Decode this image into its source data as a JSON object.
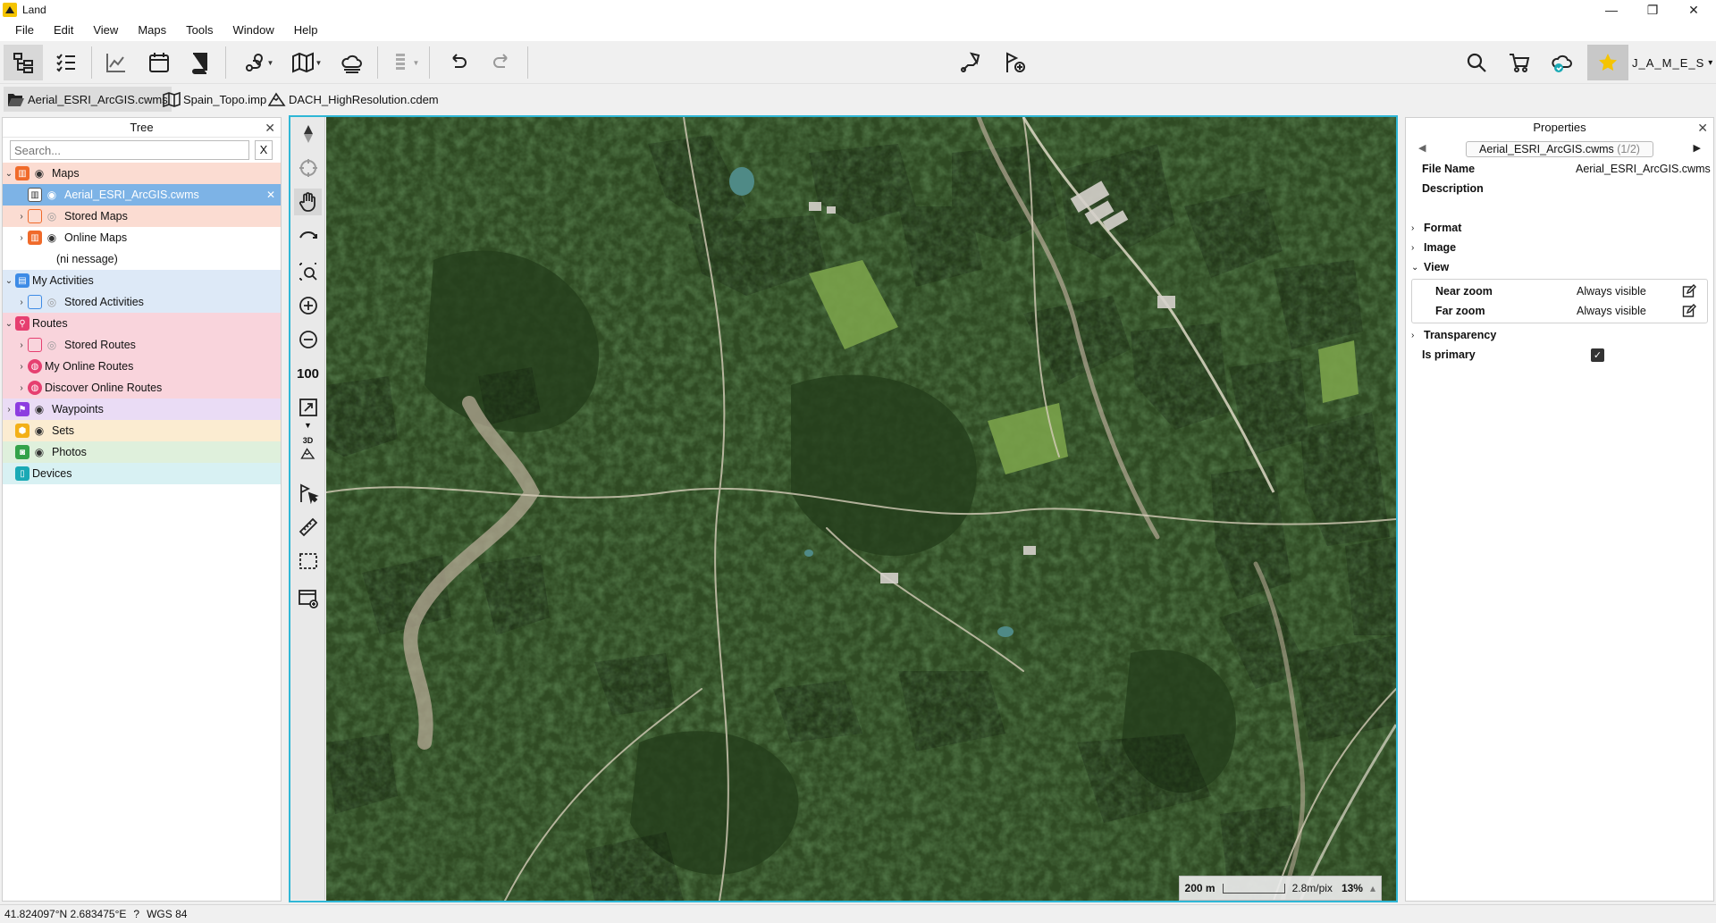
{
  "window": {
    "title": "Land",
    "minimize": "—",
    "maximize": "❐",
    "close": "✕"
  },
  "menu": [
    "File",
    "Edit",
    "View",
    "Maps",
    "Tools",
    "Window",
    "Help"
  ],
  "toolbar": {
    "user_name": "J_A_M_E_S",
    "user_caret": "▾"
  },
  "doc_tabs": [
    {
      "label": "Aerial_ESRI_ArcGIS.cwms",
      "active": true
    },
    {
      "label": "Spain_Topo.imp",
      "active": false
    },
    {
      "label": "DACH_HighResolution.cdem",
      "active": false
    }
  ],
  "tree": {
    "title": "Tree",
    "close": "✕",
    "search_placeholder": "Search...",
    "search_clear": "X",
    "rows": [
      {
        "label": "Maps",
        "chev": "⌄",
        "icon_color": "#f06a2a",
        "eye": "on",
        "bg": "maps"
      },
      {
        "label": "Aerial_ESRI_ArcGIS.cwms",
        "selected": true,
        "close": "✕",
        "eye": "on"
      },
      {
        "label": "Stored Maps",
        "chev": "›",
        "icon_color": "#f06a2a",
        "eye": "off"
      },
      {
        "label": "Online Maps",
        "chev": "›",
        "icon_color": "#f06a2a",
        "eye": "on"
      },
      {
        "label": "(ni nessage)"
      },
      {
        "label": "My Activities",
        "chev": "⌄",
        "icon_color": "#3d8be6"
      },
      {
        "label": "Stored Activities",
        "chev": "›",
        "icon_color": "#3d8be6",
        "eye": "off"
      },
      {
        "label": "Routes",
        "chev": "⌄",
        "icon_color": "#e63f70"
      },
      {
        "label": "Stored Routes",
        "chev": "›",
        "icon_color": "#e63f70",
        "eye": "off"
      },
      {
        "label": "My Online Routes",
        "chev": "›",
        "icon_color": "#e63f70"
      },
      {
        "label": "Discover Online Routes",
        "chev": "›",
        "icon_color": "#e63f70"
      },
      {
        "label": "Waypoints",
        "chev": "›",
        "icon_color": "#8d3de0",
        "eye": "on"
      },
      {
        "label": "Sets",
        "icon_color": "#f3b017",
        "eye": "on"
      },
      {
        "label": "Photos",
        "icon_color": "#34a24a",
        "eye": "on"
      },
      {
        "label": "Devices",
        "icon_color": "#1aa9b5"
      }
    ]
  },
  "map": {
    "scale_label": "200 m",
    "resolution": "2.8m/pix",
    "zoom": "13%",
    "zoom_caret": "▴",
    "zoom_in_label": "100",
    "three_d_label": "3D"
  },
  "properties": {
    "title": "Properties",
    "close": "✕",
    "prev_arrow": "◀",
    "next_arrow": "▶",
    "file_chip_name": "Aerial_ESRI_ArcGIS.cwms",
    "file_chip_count": "(1/2)",
    "file_name_key": "File Name",
    "file_name_value": "Aerial_ESRI_ArcGIS.cwms",
    "description_key": "Description",
    "sections": {
      "format": "Format",
      "image": "Image",
      "view": "View",
      "transparency": "Transparency"
    },
    "near_zoom_key": "Near zoom",
    "near_zoom_value": "Always visible",
    "far_zoom_key": "Far zoom",
    "far_zoom_value": "Always visible",
    "is_primary_key": "Is primary",
    "is_primary_checked": "✓"
  },
  "status": {
    "coords": "41.824097°N 2.683475°E",
    "unknown": "?",
    "datum": "WGS 84"
  }
}
